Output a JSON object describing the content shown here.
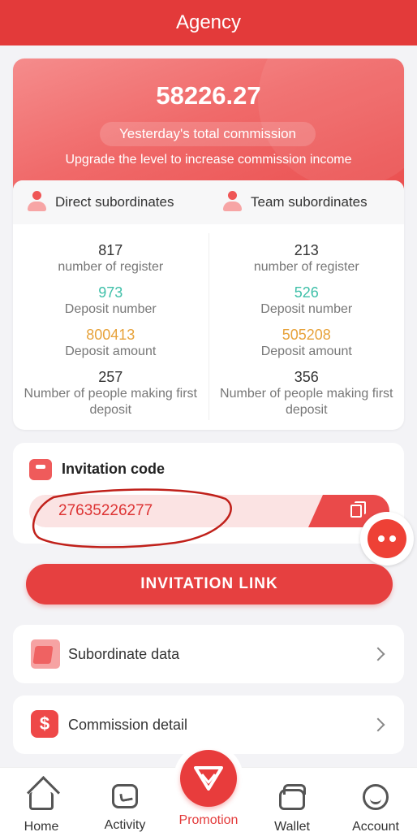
{
  "header": {
    "title": "Agency"
  },
  "commission": {
    "amount": "58226.27",
    "label": "Yesterday's total commission",
    "upgrade_text": "Upgrade the level to increase commission income"
  },
  "direct": {
    "title": "Direct subordinates",
    "register_count": "817",
    "register_label": "number of register",
    "deposit_count": "973",
    "deposit_label": "Deposit number",
    "deposit_amount": "800413",
    "amount_label": "Deposit amount",
    "first_deposit_count": "257",
    "first_deposit_label": "Number of people making first deposit"
  },
  "team": {
    "title": "Team subordinates",
    "register_count": "213",
    "register_label": "number of register",
    "deposit_count": "526",
    "deposit_label": "Deposit number",
    "deposit_amount": "505208",
    "amount_label": "Deposit amount",
    "first_deposit_count": "356",
    "first_deposit_label": "Number of people making first deposit"
  },
  "invitation": {
    "title": "Invitation code",
    "code": "27635226277",
    "link_button": "INVITATION LINK"
  },
  "menu": {
    "subordinate_data": "Subordinate data",
    "commission_detail": "Commission detail"
  },
  "nav": {
    "home": "Home",
    "activity": "Activity",
    "promotion": "Promotion",
    "wallet": "Wallet",
    "account": "Account"
  },
  "colors": {
    "brand_red": "#e33a3a",
    "teal": "#3ebfa8",
    "orange": "#e7a23a"
  }
}
